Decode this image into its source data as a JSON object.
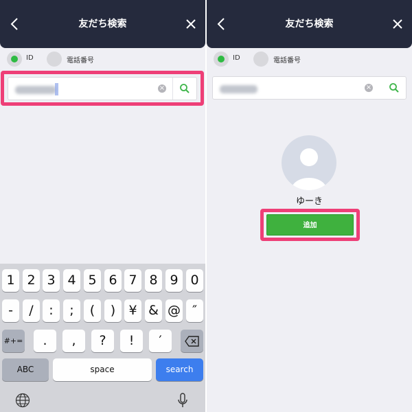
{
  "left": {
    "header": {
      "title": "友だち検索"
    },
    "radio": {
      "id_label": "ID",
      "phone_label": "電話番号",
      "selected": "ID"
    },
    "search": {
      "placeholder": ""
    },
    "keyboard": {
      "row1": [
        "1",
        "2",
        "3",
        "4",
        "5",
        "6",
        "7",
        "8",
        "9",
        "0"
      ],
      "row2": [
        "-",
        "/",
        ":",
        ";",
        "(",
        ")",
        "¥",
        "&",
        "@",
        "″"
      ],
      "row3": [
        ".",
        ",",
        "?",
        "!",
        "′"
      ],
      "shift": "#+=",
      "abc": "ABC",
      "space": "space",
      "search": "search"
    }
  },
  "right": {
    "header": {
      "title": "友だち検索"
    },
    "radio": {
      "id_label": "ID",
      "phone_label": "電話番号",
      "selected": "ID"
    },
    "profile": {
      "name": "ゆーき"
    },
    "add_button": "追加"
  },
  "colors": {
    "header_bg": "#252a3d",
    "accent_green": "#2fbb43",
    "highlight_pink": "#ee3f77",
    "search_key_blue": "#3d7eee"
  },
  "icons": [
    "back-arrow-icon",
    "close-icon",
    "clear-icon",
    "search-icon",
    "backspace-icon",
    "globe-icon",
    "microphone-icon",
    "avatar-icon"
  ]
}
